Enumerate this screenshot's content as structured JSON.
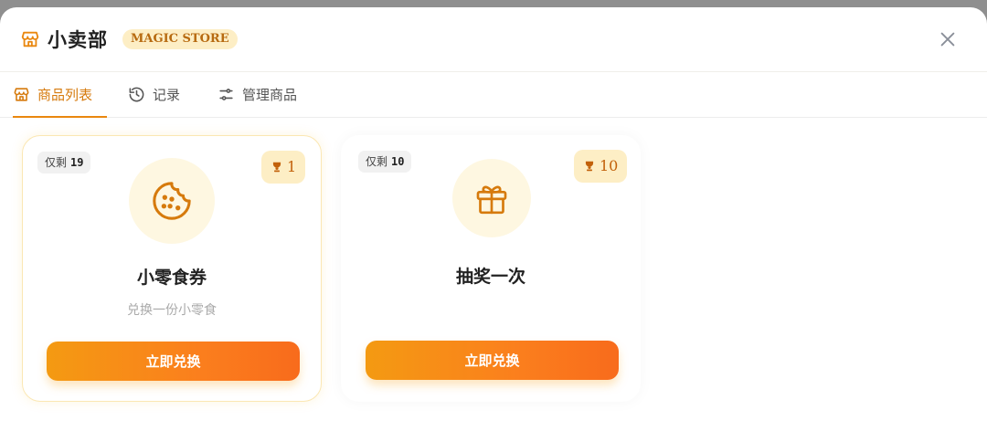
{
  "header": {
    "title": "小卖部",
    "badge": "MAGIC STORE",
    "store_icon": "store-icon",
    "close_icon": "close-icon"
  },
  "tabs": [
    {
      "label": "商品列表",
      "icon": "store-icon",
      "active": true
    },
    {
      "label": "记录",
      "icon": "history-icon",
      "active": false
    },
    {
      "label": "管理商品",
      "icon": "sliders-icon",
      "active": false
    }
  ],
  "products": [
    {
      "stock_label": "仅剩",
      "stock": "19",
      "price": "1",
      "name": "小零食券",
      "desc": "兑换一份小零食",
      "icon": "cookie-icon",
      "button": "立即兑换"
    },
    {
      "stock_label": "仅剩",
      "stock": "10",
      "price": "10",
      "name": "抽奖一次",
      "desc": "",
      "icon": "gift-icon",
      "button": "立即兑换"
    }
  ],
  "colors": {
    "accent": "#e9870f",
    "badge_bg": "#fdeec5",
    "button_start": "#f49a12",
    "button_end": "#f86b1c"
  }
}
